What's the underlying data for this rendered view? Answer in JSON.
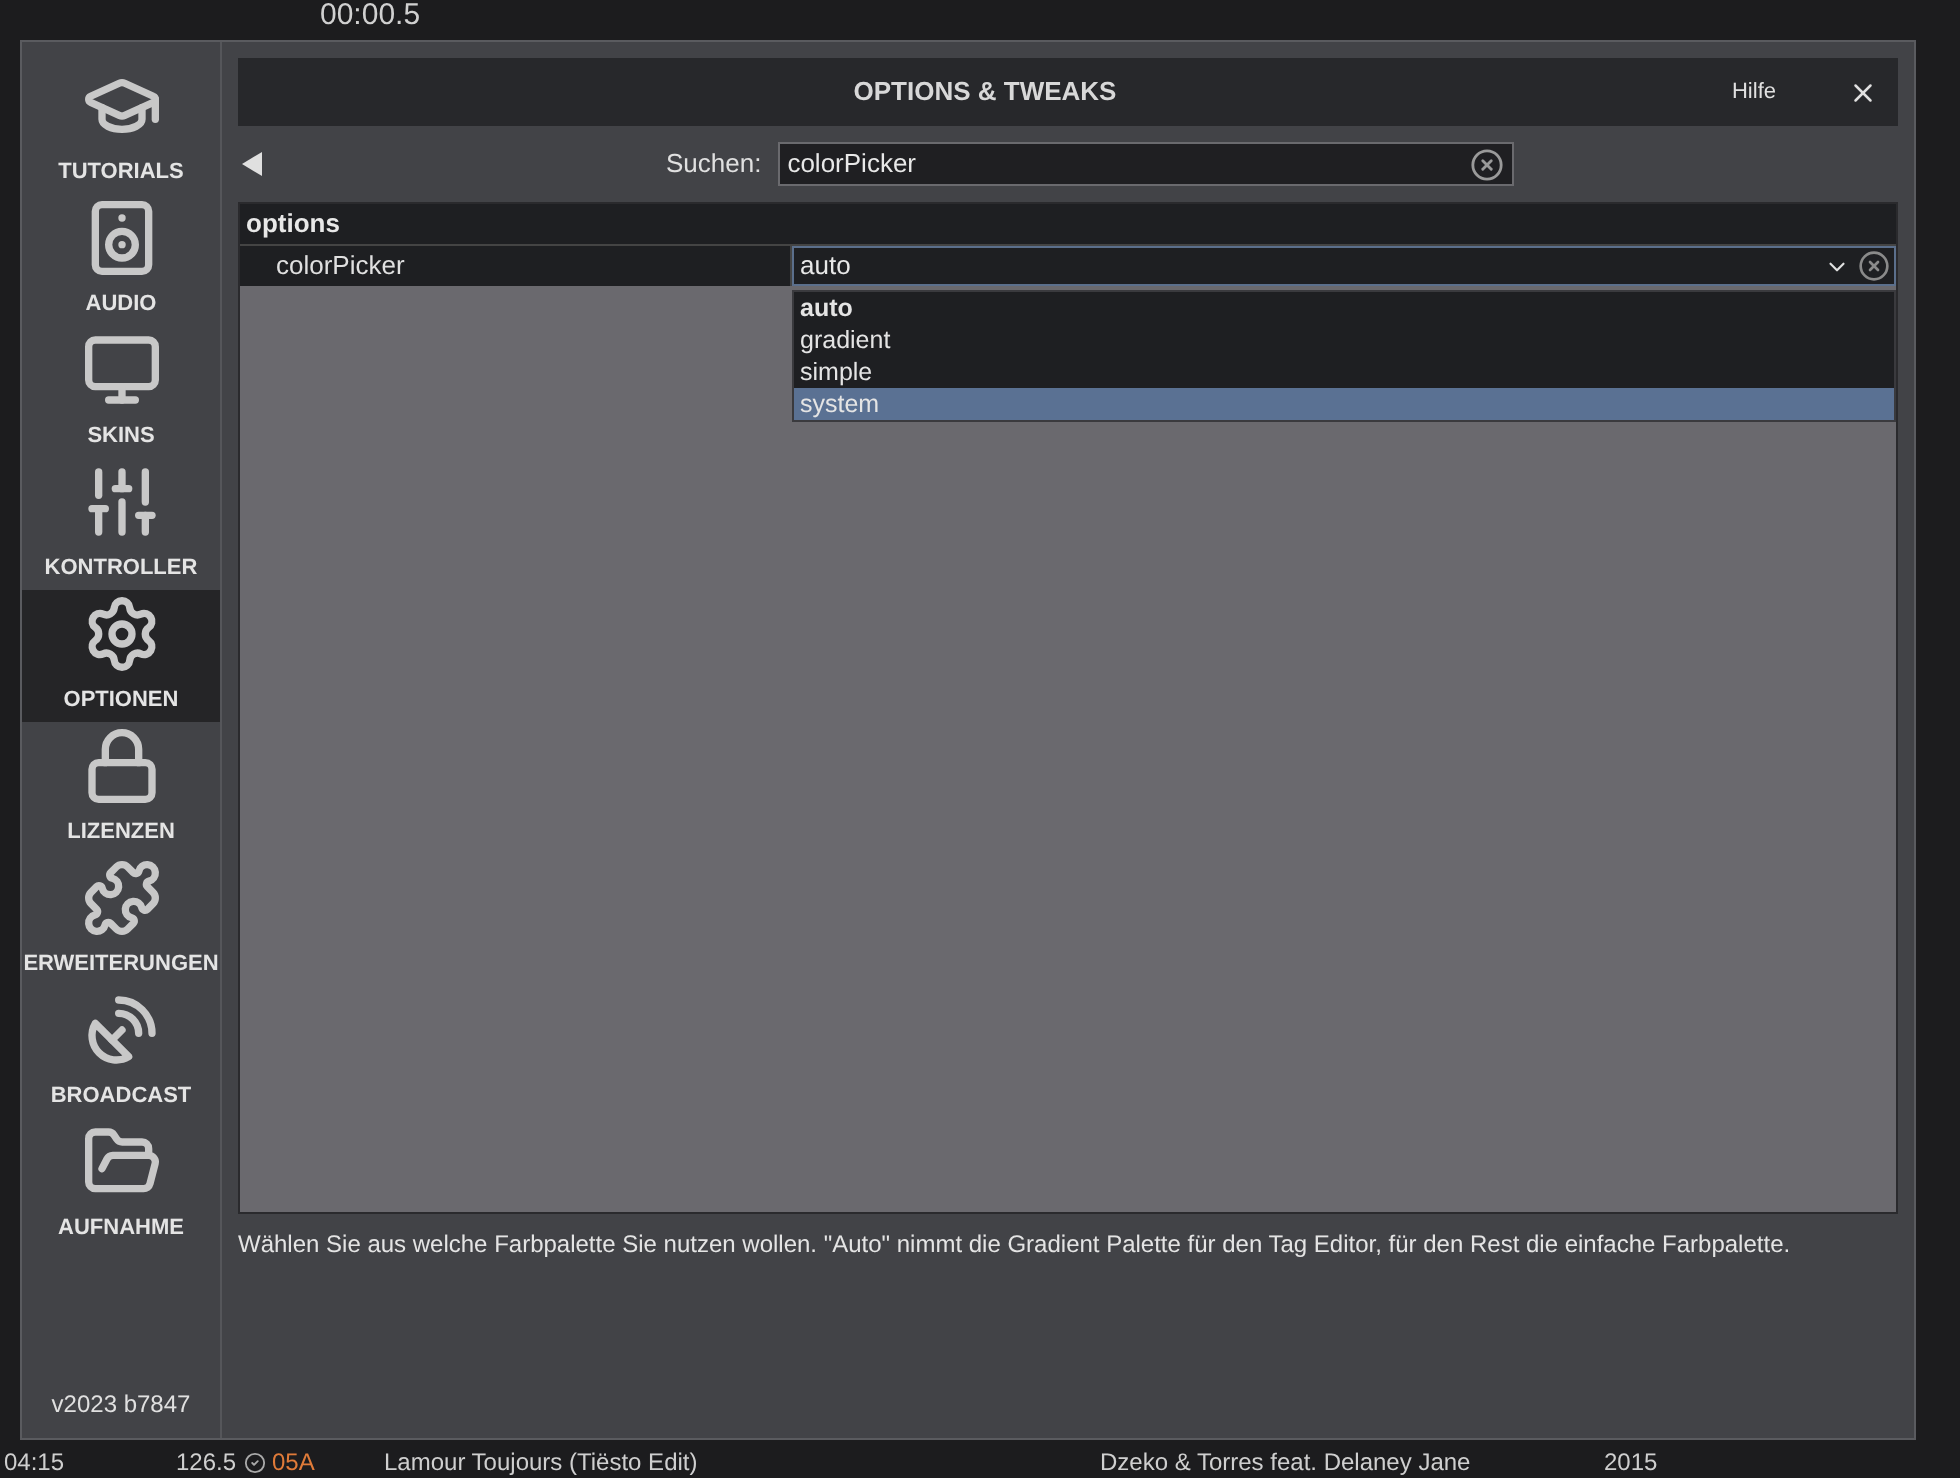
{
  "background": {
    "deck_time": "00:00.5",
    "track_row": {
      "time": "04:15",
      "bpm": "126.5",
      "key": "05A",
      "title": "Lamour Toujours (Tiësto Edit)",
      "artist": "Dzeko & Torres feat. Delaney Jane",
      "year": "2015"
    }
  },
  "sidebar": {
    "items": [
      {
        "label": "TUTORIALS",
        "selected": false
      },
      {
        "label": "AUDIO",
        "selected": false
      },
      {
        "label": "SKINS",
        "selected": false
      },
      {
        "label": "KONTROLLER",
        "selected": false
      },
      {
        "label": "OPTIONEN",
        "selected": true
      },
      {
        "label": "LIZENZEN",
        "selected": false
      },
      {
        "label": "ERWEITERUNGEN",
        "selected": false
      },
      {
        "label": "BROADCAST",
        "selected": false
      },
      {
        "label": "AUFNAHME",
        "selected": false
      }
    ],
    "version": "v2023 b7847"
  },
  "dialog": {
    "title": "OPTIONS & TWEAKS",
    "help": "Hilfe",
    "search": {
      "label": "Suchen:",
      "value": "colorPicker"
    },
    "group": "options",
    "rows": [
      {
        "name": "colorPicker",
        "value": "auto"
      }
    ],
    "dropdown": {
      "options": [
        {
          "label": "auto",
          "current": true,
          "selected": false
        },
        {
          "label": "gradient",
          "current": false,
          "selected": false
        },
        {
          "label": "simple",
          "current": false,
          "selected": false
        },
        {
          "label": "system",
          "current": false,
          "selected": true
        }
      ]
    },
    "description": "Wählen Sie aus welche Farbpalette Sie nutzen wollen. \"Auto\" nimmt die Gradient Palette für den Tag Editor, für den Rest die einfache Farbpalette."
  }
}
